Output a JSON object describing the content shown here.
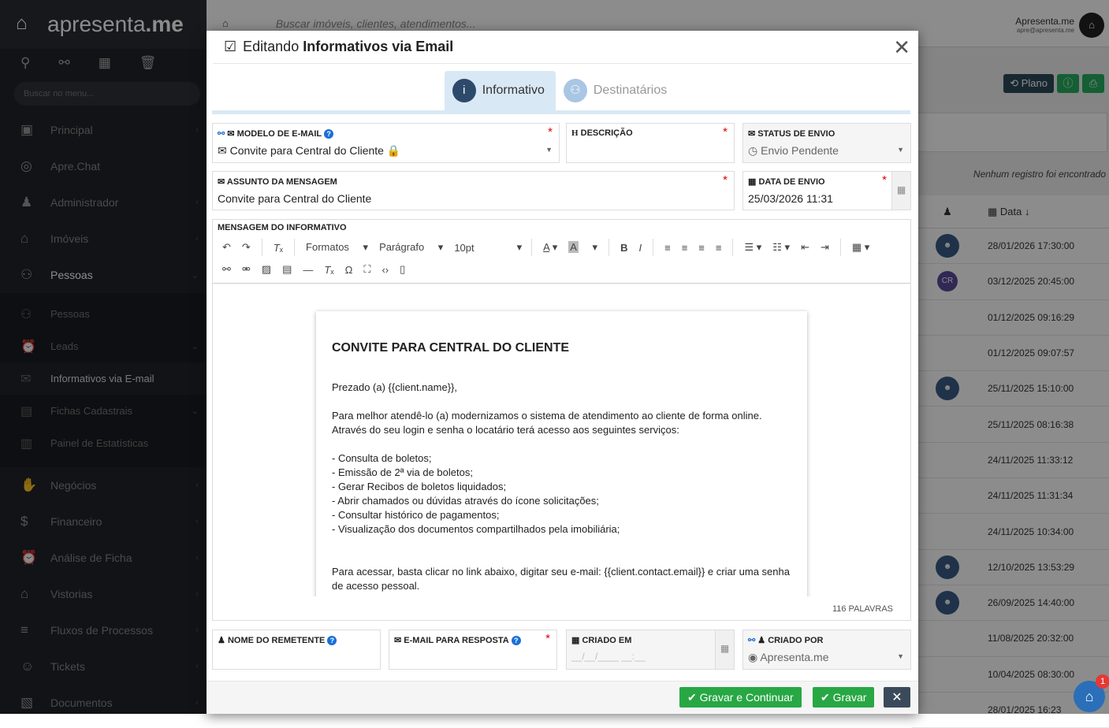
{
  "sidebar": {
    "brand": "apresenta",
    "brand_bold": ".me",
    "search_placeholder": "Buscar no menu...",
    "items": [
      {
        "label": "Principal",
        "icon": "dashboard-icon"
      },
      {
        "label": "Apre.Chat",
        "icon": "whatsapp-icon"
      },
      {
        "label": "Administrador",
        "icon": "user-icon"
      },
      {
        "label": "Imóveis",
        "icon": "home-icon"
      },
      {
        "label": "Pessoas",
        "icon": "people-icon"
      }
    ],
    "subitems": [
      {
        "label": "Pessoas"
      },
      {
        "label": "Leads"
      },
      {
        "label": "Informativos via E-mail"
      },
      {
        "label": "Fichas Cadastrais"
      },
      {
        "label": "Painel de Estatísticas"
      }
    ],
    "items2": [
      {
        "label": "Negócios"
      },
      {
        "label": "Financeiro"
      },
      {
        "label": "Análise de Ficha"
      },
      {
        "label": "Vistorias"
      },
      {
        "label": "Fluxos de Processos"
      },
      {
        "label": "Tickets"
      },
      {
        "label": "Documentos"
      }
    ]
  },
  "topbar": {
    "search_placeholder": "Buscar imóveis, clientes, atendimentos...",
    "user_name": "Apresenta.me",
    "user_email": "apre@apresenta.me",
    "plano_label": "Plano"
  },
  "list": {
    "no_records": "Nenhum registro foi encontrado",
    "date_header": "Data",
    "dates": [
      "28/01/2026 17:30:00",
      "03/12/2025 20:45:00",
      "01/12/2025 09:16:29",
      "01/12/2025 09:07:57",
      "25/11/2025 15:10:00",
      "25/11/2025 08:16:38",
      "24/11/2025 11:33:12",
      "24/11/2025 11:31:34",
      "24/11/2025 10:34:00",
      "12/10/2025 13:53:29",
      "26/09/2025 14:40:00",
      "11/08/2025 20:32:00",
      "10/04/2025 08:30:00",
      "28/01/2025 16:23"
    ],
    "cr_initials": "CR"
  },
  "modal": {
    "title_prefix": "Editando",
    "title_bold": "Informativos via Email",
    "tabs": [
      {
        "label": "Informativo"
      },
      {
        "label": "Destinatários"
      }
    ],
    "fields": {
      "modelo_label": "MODELO DE E-MAIL",
      "modelo_value": "Convite para Central do Cliente",
      "descricao_label": "DESCRIÇÃO",
      "status_label": "STATUS DE ENVIO",
      "status_value": "Envio Pendente",
      "assunto_label": "ASSUNTO DA MENSAGEM",
      "assunto_value": "Convite para Central do Cliente",
      "data_label": "DATA DE ENVIO",
      "data_value": "25/03/2026 11:31",
      "mensagem_label": "MENSAGEM DO INFORMATIVO",
      "remetente_label": "NOME DO REMETENTE",
      "email_resp_label": "E-MAIL PARA RESPOSTA",
      "criado_em_label": "CRIADO EM",
      "criado_em_value": "__/__/____ __:__",
      "criado_por_label": "CRIADO POR",
      "criado_por_value": "Apresenta.me"
    },
    "toolbar": {
      "formats": "Formatos",
      "paragraph": "Parágrafo",
      "size": "10pt"
    },
    "content": {
      "heading": "CONVITE PARA CENTRAL DO CLIENTE",
      "greeting": "Prezado (a) {{client.name}},",
      "p1a": "Para melhor atendê-lo (a) modernizamos o sistema de atendimento ao cliente de forma online.",
      "p1b": "Através do seu login e senha o locatário terá acesso aos seguintes serviços:",
      "list": [
        "- Consulta de boletos;",
        "- Emissão de 2ª via de boletos;",
        "- Gerar Recibos de boletos liquidados;",
        "- Abrir chamados ou dúvidas através do ícone solicitações;",
        "- Consultar histórico de pagamentos;",
        "- Visualização dos documentos compartilhados pela imobiliária;"
      ],
      "p2": "Para acessar, basta clicar no link abaixo, digitar seu e-mail: {{client.contact.email}} e criar uma senha de acesso pessoal."
    },
    "word_count": "116 PALAVRAS",
    "save_continue": "Gravar e Continuar",
    "save": "Gravar"
  },
  "help_badge": "1"
}
